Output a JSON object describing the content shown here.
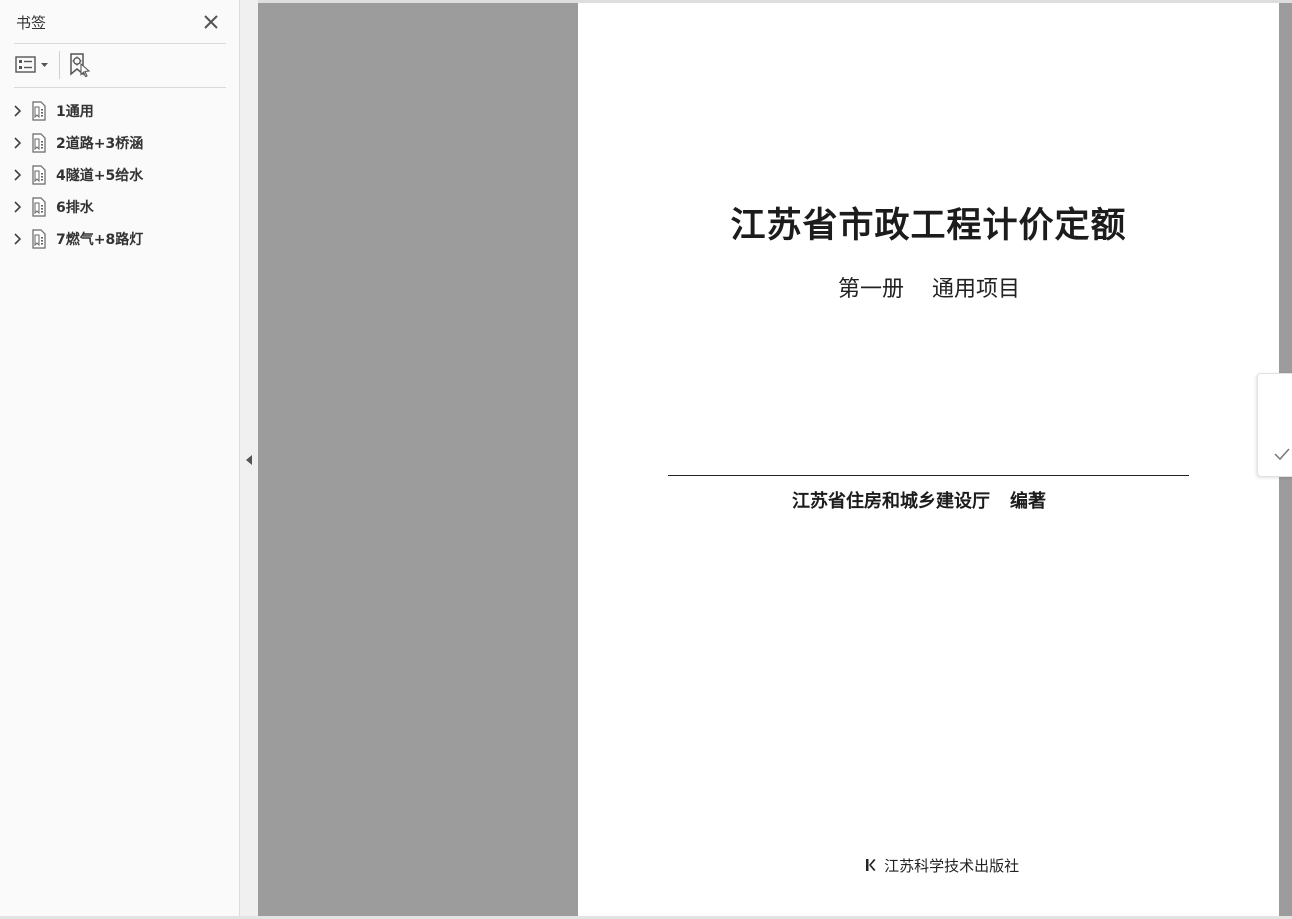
{
  "bookmarks_panel": {
    "title": "书签",
    "close_icon": "close-icon",
    "options_icon": "list-options-icon",
    "new_bookmark_icon": "new-bookmark-icon",
    "items": [
      {
        "label": "1通用",
        "icon": "bookmark-page-icon",
        "expanded": false
      },
      {
        "label": "2道路+3桥涵",
        "icon": "bookmark-page-icon",
        "expanded": false
      },
      {
        "label": "4隧道+5给水",
        "icon": "bookmark-page-icon",
        "expanded": false
      },
      {
        "label": "6排水",
        "icon": "bookmark-page-icon",
        "expanded": false
      },
      {
        "label": "7燃气+8路灯",
        "icon": "bookmark-page-icon",
        "expanded": false
      }
    ]
  },
  "document": {
    "title": "江苏省市政工程计价定额",
    "volume": "第一册",
    "volume_name": "通用项目",
    "author_org": "江苏省住房和城乡建设厅",
    "author_role": "编著",
    "publisher": "江苏科学技术出版社"
  },
  "colors": {
    "viewer_background": "#9c9c9c",
    "page": "#ffffff",
    "panel": "#fafafa"
  }
}
